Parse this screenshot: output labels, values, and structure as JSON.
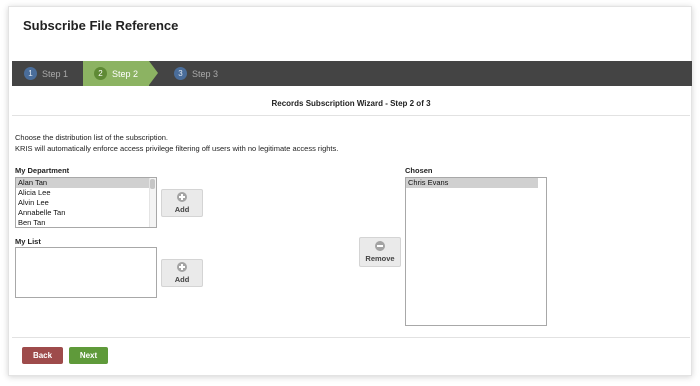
{
  "page": {
    "title": "Subscribe File Reference"
  },
  "steps": [
    {
      "num": "1",
      "label": "Step 1"
    },
    {
      "num": "2",
      "label": "Step 2"
    },
    {
      "num": "3",
      "label": "Step 3"
    }
  ],
  "wizard": {
    "title": "Records Subscription Wizard - Step 2 of 3",
    "instruction_line1": "Choose the distribution list of the subscription.",
    "instruction_line2": "KRIS will automatically enforce access privilege filtering off users with no legitimate access rights."
  },
  "my_department": {
    "label": "My Department",
    "items": [
      "Alan Tan",
      "Alicia Lee",
      "Alvin Lee",
      "Annabelle Tan",
      "Ben Tan"
    ],
    "selected": "Alan Tan"
  },
  "my_list": {
    "label": "My List",
    "items": []
  },
  "chosen": {
    "label": "Chosen",
    "items": [
      "Chris Evans"
    ],
    "selected": "Chris Evans"
  },
  "buttons": {
    "add_department": "Add",
    "add_my_list": "Add",
    "remove": "Remove",
    "back": "Back",
    "next": "Next"
  },
  "colors": {
    "stepbar_bg": "#444444",
    "active_step": "#8cb362",
    "back_button": "#9e4b4b",
    "next_button": "#5f9a3a"
  },
  "icons": {
    "add": "plus-circle-icon",
    "remove": "minus-circle-icon"
  }
}
